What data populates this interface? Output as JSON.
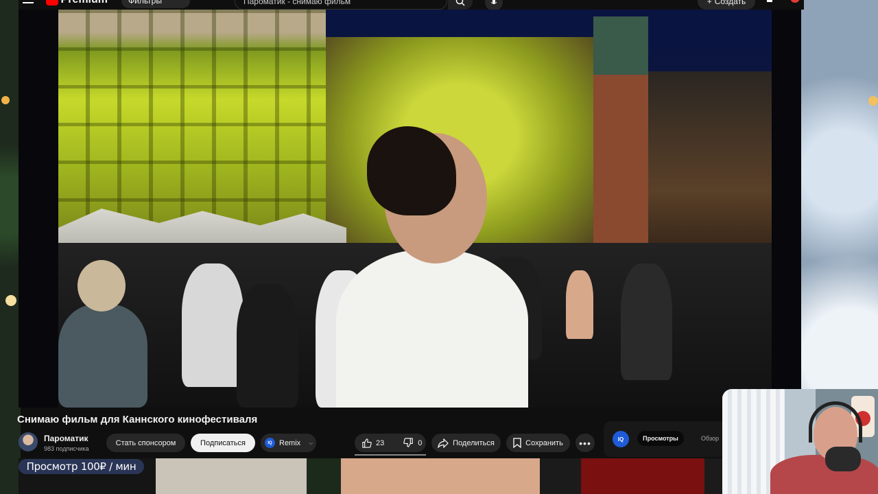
{
  "topbar": {
    "logo_text": "Premium",
    "chip_label": "Фильтры",
    "search_text": "Пароматик - снимаю фильм",
    "create_label": "Создать"
  },
  "video": {
    "title": "Снимаю фильм для Каннского кинофестиваля"
  },
  "channel": {
    "name": "Пароматик",
    "subscribers": "983 подписчика"
  },
  "actions": {
    "sponsor_label": "Стать спонсором",
    "subscribe_label": "Подписаться",
    "remix_label": "Remix",
    "iq_label": "IQ",
    "likes": "23",
    "dislikes": "0",
    "share_label": "Поделиться",
    "save_label": "Сохранить"
  },
  "iq_panel": {
    "iq_label": "IQ",
    "tab_views": "Просмотры",
    "tab_review": "Обзор"
  },
  "overlay": {
    "price_text": "Просмотр 100₽ / мин"
  },
  "colors": {
    "accent": "#1f5bd8",
    "subscribe_bg": "#f1f1f1",
    "pill_bg": "#272727",
    "price_badge_bg": "#2a3556"
  }
}
